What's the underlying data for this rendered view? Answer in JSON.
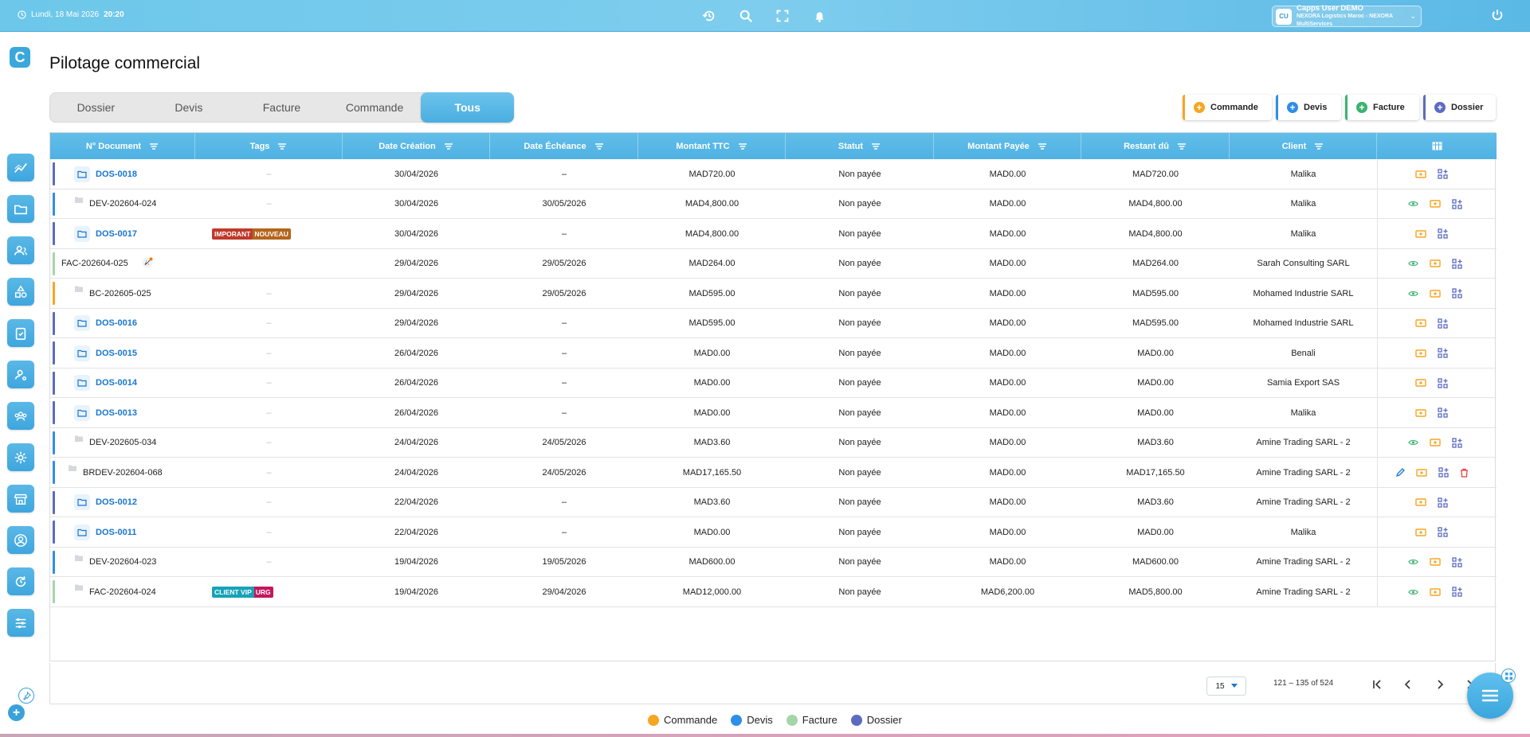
{
  "topbar": {
    "date": "Lundi, 18 Mai 2026",
    "time": "20:20",
    "user_initials": "CU",
    "user_name": "Capps User DEMO",
    "user_org": "NEXORA Logistics Maroc - NEXORA MultiServices"
  },
  "logo": "C",
  "page_title": "Pilotage commercial",
  "tabs": [
    "Dossier",
    "Devis",
    "Facture",
    "Commande",
    "Tous"
  ],
  "active_tab": "Tous",
  "quick_add": [
    {
      "label": "Commande",
      "color": "#f5a623"
    },
    {
      "label": "Devis",
      "color": "#2f8ee6"
    },
    {
      "label": "Facture",
      "color": "#3cb371"
    },
    {
      "label": "Dossier",
      "color": "#5c6bc0"
    }
  ],
  "table": {
    "headers": [
      "N° Document",
      "Tags",
      "Date Création",
      "Date Échéance",
      "Montant TTC",
      "Statut",
      "Montant Payée",
      "Restant dû",
      "Client"
    ],
    "rows": [
      {
        "doc": "DOS-0018",
        "kind": "dossier",
        "tags": "–",
        "created": "30/04/2026",
        "due": "–",
        "ttc": "MAD720.00",
        "status": "Non payée",
        "paid": "MAD0.00",
        "rest": "MAD720.00",
        "client": "Malika"
      },
      {
        "doc": "DEV-202604-024",
        "kind": "devis",
        "tags": "–",
        "created": "30/04/2026",
        "due": "30/05/2026",
        "ttc": "MAD4,800.00",
        "status": "Non payée",
        "paid": "MAD0.00",
        "rest": "MAD4,800.00",
        "client": "Malika"
      },
      {
        "doc": "DOS-0017",
        "kind": "dossier",
        "tags": "",
        "tag1": "IMPORANT",
        "tag2": "NOUVEAU",
        "created": "30/04/2026",
        "due": "–",
        "ttc": "MAD4,800.00",
        "status": "Non payée",
        "paid": "MAD0.00",
        "rest": "MAD4,800.00",
        "client": "Malika"
      },
      {
        "doc": "FAC-202604-025",
        "kind": "facture",
        "tags": "",
        "created": "29/04/2026",
        "due": "29/05/2026",
        "ttc": "MAD264.00",
        "status": "Non payée",
        "paid": "MAD0.00",
        "rest": "MAD264.00",
        "client": "Sarah Consulting SARL"
      },
      {
        "doc": "BC-202605-025",
        "kind": "commande",
        "tags": "–",
        "created": "29/04/2026",
        "due": "29/05/2026",
        "ttc": "MAD595.00",
        "status": "Non payée",
        "paid": "MAD0.00",
        "rest": "MAD595.00",
        "client": "Mohamed Industrie SARL"
      },
      {
        "doc": "DOS-0016",
        "kind": "dossier",
        "tags": "–",
        "created": "29/04/2026",
        "due": "–",
        "ttc": "MAD595.00",
        "status": "Non payée",
        "paid": "MAD0.00",
        "rest": "MAD595.00",
        "client": "Mohamed Industrie SARL"
      },
      {
        "doc": "DOS-0015",
        "kind": "dossier",
        "tags": "–",
        "created": "26/04/2026",
        "due": "–",
        "ttc": "MAD0.00",
        "status": "Non payée",
        "paid": "MAD0.00",
        "rest": "MAD0.00",
        "client": "Benali"
      },
      {
        "doc": "DOS-0014",
        "kind": "dossier",
        "tags": "–",
        "created": "26/04/2026",
        "due": "–",
        "ttc": "MAD0.00",
        "status": "Non payée",
        "paid": "MAD0.00",
        "rest": "MAD0.00",
        "client": "Samia Export SAS"
      },
      {
        "doc": "DOS-0013",
        "kind": "dossier",
        "tags": "–",
        "created": "26/04/2026",
        "due": "–",
        "ttc": "MAD0.00",
        "status": "Non payée",
        "paid": "MAD0.00",
        "rest": "MAD0.00",
        "client": "Malika"
      },
      {
        "doc": "DEV-202605-034",
        "kind": "devis",
        "tags": "–",
        "created": "24/04/2026",
        "due": "24/05/2026",
        "ttc": "MAD3.60",
        "status": "Non payée",
        "paid": "MAD0.00",
        "rest": "MAD3.60",
        "client": "Amine Trading SARL - 2"
      },
      {
        "doc": "BRDEV-202604-068",
        "kind": "brdevis",
        "tags": "–",
        "created": "24/04/2026",
        "due": "24/05/2026",
        "ttc": "MAD17,165.50",
        "status": "Non payée",
        "paid": "MAD0.00",
        "rest": "MAD17,165.50",
        "client": "Amine Trading SARL - 2"
      },
      {
        "doc": "DOS-0012",
        "kind": "dossier",
        "tags": "–",
        "created": "22/04/2026",
        "due": "–",
        "ttc": "MAD3.60",
        "status": "Non payée",
        "paid": "MAD0.00",
        "rest": "MAD3.60",
        "client": "Amine Trading SARL - 2"
      },
      {
        "doc": "DOS-0011",
        "kind": "dossier",
        "tags": "–",
        "created": "22/04/2026",
        "due": "–",
        "ttc": "MAD0.00",
        "status": "Non payée",
        "paid": "MAD0.00",
        "rest": "MAD0.00",
        "client": "Malika"
      },
      {
        "doc": "DEV-202604-023",
        "kind": "devis",
        "tags": "–",
        "created": "19/04/2026",
        "due": "19/05/2026",
        "ttc": "MAD600.00",
        "status": "Non payée",
        "paid": "MAD0.00",
        "rest": "MAD600.00",
        "client": "Amine Trading SARL - 2"
      },
      {
        "doc": "FAC-202604-024",
        "kind": "facture",
        "tags": "",
        "tag1": "CLIENT VIP",
        "tag2": "URG",
        "created": "19/04/2026",
        "due": "29/04/2026",
        "ttc": "MAD12,000.00",
        "status": "Non payée",
        "paid": "MAD6,200.00",
        "rest": "MAD5,800.00",
        "client": "Amine Trading SARL - 2"
      }
    ]
  },
  "pagination": {
    "page_size": "15",
    "range": "121 – 135 of 524"
  },
  "legend": [
    {
      "label": "Commande",
      "color": "#f5a623"
    },
    {
      "label": "Devis",
      "color": "#2f8ee6"
    },
    {
      "label": "Facture",
      "color": "#a5d6a7"
    },
    {
      "label": "Dossier",
      "color": "#5c6bc0"
    }
  ],
  "colors": {
    "accent": "#4fb2e3",
    "dossier": "#5c6bc0",
    "devis": "#2f8ee6",
    "facture": "#a5d6a7",
    "commande": "#f5a623"
  }
}
